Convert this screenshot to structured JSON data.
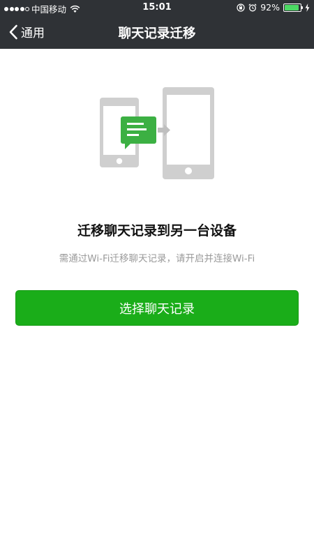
{
  "status_bar": {
    "carrier": "中国移动",
    "time": "15:01",
    "battery_percent": "92%",
    "battery_level": 0.92,
    "signal_bars_filled": 4,
    "signal_bars_total": 5
  },
  "nav": {
    "back_label": "通用",
    "title": "聊天记录迁移"
  },
  "content": {
    "heading": "迁移聊天记录到另一台设备",
    "description": "需通过Wi-Fi迁移聊天记录，请开启并连接Wi-Fi",
    "button_label": "选择聊天记录"
  },
  "icons": {
    "back": "chevron-left-icon",
    "wifi": "wifi-icon",
    "lock_rotation": "orientation-lock-icon",
    "alarm": "alarm-icon",
    "battery": "battery-icon",
    "charging": "charging-icon",
    "illustration": "phone-to-tablet-transfer-icon"
  },
  "colors": {
    "nav_background": "#2f3236",
    "primary_green": "#1aad19",
    "message_green": "#3cb043",
    "device_gray": "#cfcfcf"
  }
}
